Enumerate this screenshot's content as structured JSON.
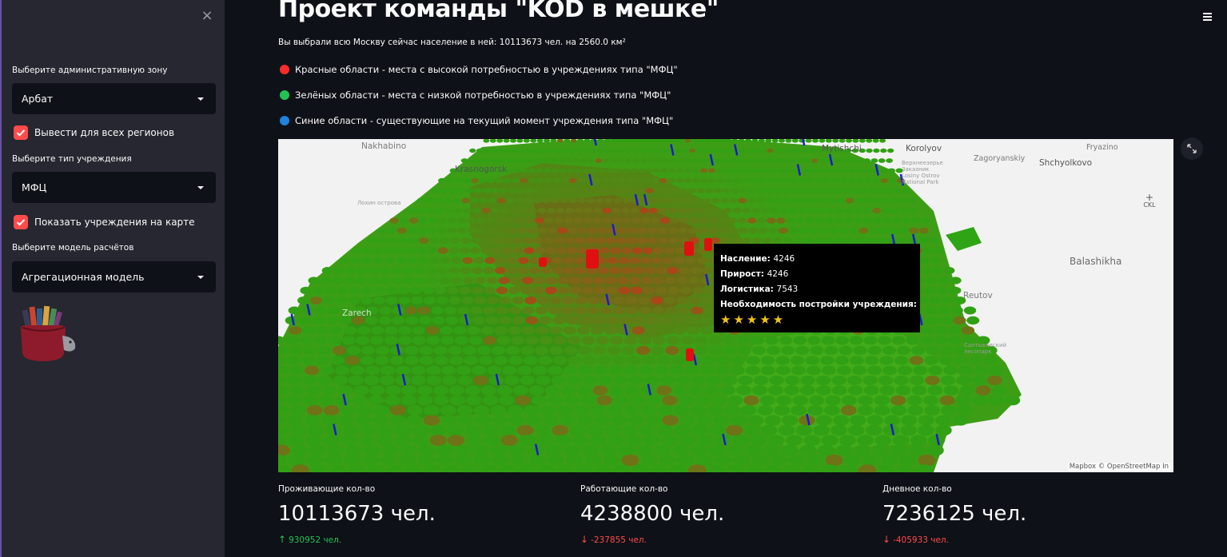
{
  "sidebar": {
    "close_icon": "×",
    "zone_label": "Выберите административную зону",
    "zone_value": "Арбат",
    "all_regions_label": "Вывести для всех регионов",
    "all_regions_checked": true,
    "type_label": "Выберите тип учреждения",
    "type_value": "МФЦ",
    "show_institutions_label": "Показать учреждения на карте",
    "show_institutions_checked": true,
    "model_label": "Выберите модель расчётов",
    "model_value": "Агрегационная модель",
    "logo_icon": "kod-bag-logo-icon"
  },
  "main": {
    "title": "Проект команды \"KOD в мешке\"",
    "info": "Вы выбрали всю Москву сейчас население в ней: 10113673 чел. на 2560.0 км²",
    "legend": [
      {
        "color": "#ff2b2b",
        "text": "Красные области - места с высокой потребностью в учреждениях типа \"МФЦ\""
      },
      {
        "color": "#21c354",
        "text": "Зелёных области - места с низкой потребностью в учреждениях типа \"МФЦ\""
      },
      {
        "color": "#1c83e1",
        "text": "Синие области - существующие на текущий момент учреждения типа \"МФЦ\""
      }
    ]
  },
  "map": {
    "labels": {
      "nakhabino": "Nakhabino",
      "krasnogorsk": "Krasnogorsk",
      "mytishchi": "Mytishchi",
      "korolyov": "Korolyov",
      "fryazino": "Fryazino",
      "zagoryanskiy": "Zagoryanskiy",
      "shchyolkovo": "Shchyolkovo",
      "balashikha": "Balashikha",
      "reutov": "Reutov",
      "zarech": "Zarech",
      "losiny": "Верхнеезерье\nЗаказник\nLosiny Ostrov\nNational Park",
      "lozhin": "Лохин острова",
      "saltykovsky": "Салтыковский\nлесопарк",
      "compass": "CKL"
    },
    "attribution": "Mapbox © OpenStreetMap In",
    "tooltip": {
      "population_label": "Насление:",
      "population_value": "4246",
      "growth_label": "Прирост:",
      "growth_value": "4246",
      "logistics_label": "Логистика:",
      "logistics_value": "7543",
      "need_label": "Необходимость постройки учреждения:",
      "stars": "★★★★★"
    },
    "fullscreen_icon": "expand-icon",
    "colors": {
      "low": "#2aa412",
      "high": "#e01010",
      "existing": "#1a1ad0"
    }
  },
  "metrics": [
    {
      "label": "Проживающие кол-во",
      "value": "10113673 чел.",
      "delta": "930952 чел.",
      "direction": "up",
      "color": "#21c354"
    },
    {
      "label": "Работающие кол-во",
      "value": "4238800 чел.",
      "delta": "-237855 чел.",
      "direction": "down",
      "color": "#ff4b4b"
    },
    {
      "label": "Дневное кол-во",
      "value": "7236125 чел.",
      "delta": "-405933 чел.",
      "direction": "down",
      "color": "#ff4b4b"
    }
  ]
}
